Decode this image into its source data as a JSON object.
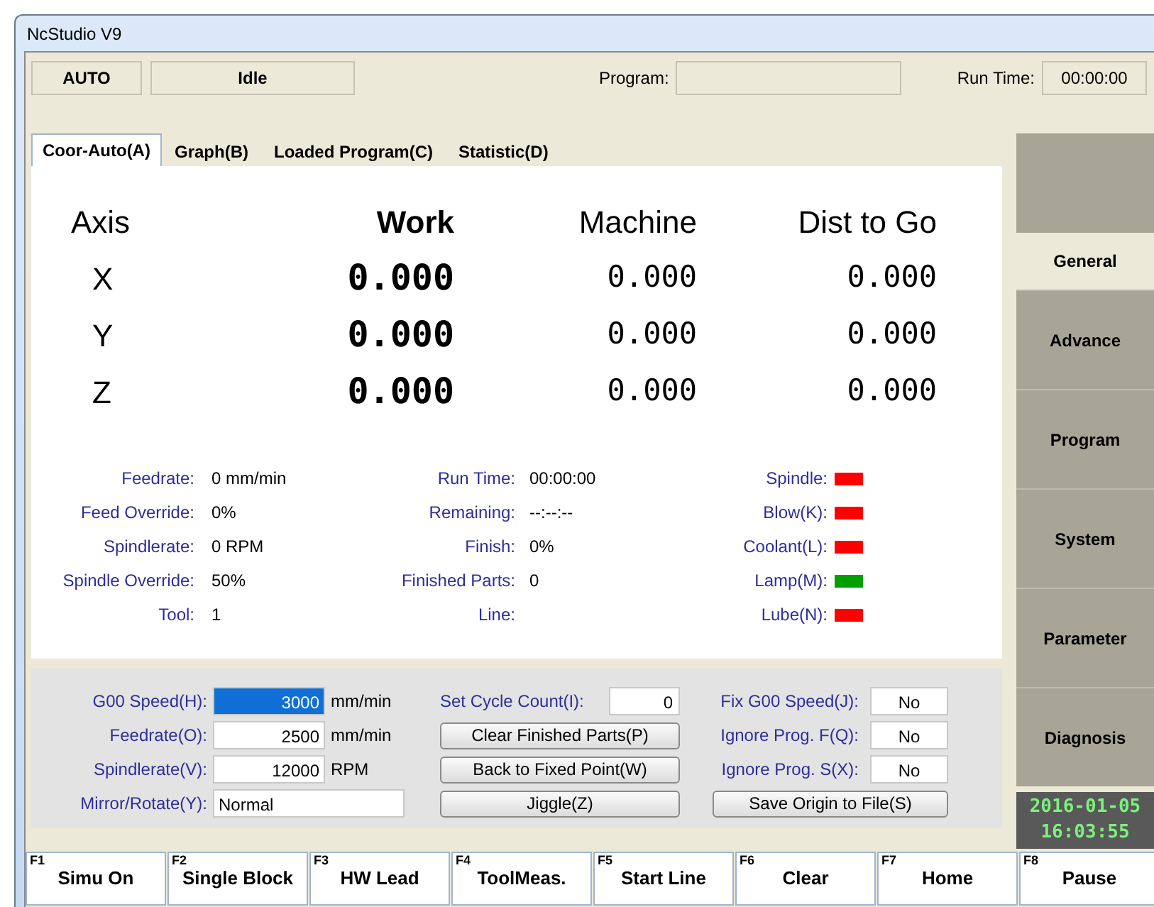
{
  "window": {
    "title": "NcStudio V9"
  },
  "status": {
    "mode": "AUTO",
    "state": "Idle",
    "program_label": "Program:",
    "run_time_label": "Run Time:",
    "run_time": "00:00:00"
  },
  "tabs": [
    {
      "label": "Coor-Auto(A)",
      "selected": true
    },
    {
      "label": "Graph(B)",
      "selected": false
    },
    {
      "label": "Loaded Program(C)",
      "selected": false
    },
    {
      "label": "Statistic(D)",
      "selected": false
    }
  ],
  "coordinates": {
    "headers": [
      "Axis",
      "Work",
      "Machine",
      "Dist to Go"
    ],
    "rows": [
      {
        "axis": "X",
        "work": "0.000",
        "machine": "0.000",
        "dist": "0.000"
      },
      {
        "axis": "Y",
        "work": "0.000",
        "machine": "0.000",
        "dist": "0.000"
      },
      {
        "axis": "Z",
        "work": "0.000",
        "machine": "0.000",
        "dist": "0.000"
      }
    ]
  },
  "info_left": [
    {
      "label": "Feedrate:",
      "value": "0 mm/min"
    },
    {
      "label": "Feed Override:",
      "value": "0%"
    },
    {
      "label": "Spindlerate:",
      "value": "0 RPM"
    },
    {
      "label": "Spindle Override:",
      "value": "50%"
    },
    {
      "label": "Tool:",
      "value": "1"
    }
  ],
  "info_middle": [
    {
      "label": "Run Time:",
      "value": "00:00:00"
    },
    {
      "label": "Remaining:",
      "value": "--:--:--"
    },
    {
      "label": "Finish:",
      "value": "0%"
    },
    {
      "label": "Finished Parts:",
      "value": "0"
    },
    {
      "label": "Line:"
    }
  ],
  "indicators": [
    {
      "label": "Spindle:",
      "color": "#ff0000"
    },
    {
      "label": "Blow(K):",
      "color": "#ff0000"
    },
    {
      "label": "Coolant(L):",
      "color": "#ff0000"
    },
    {
      "label": "Lamp(M):",
      "color": "#00a000"
    },
    {
      "label": "Lube(N):",
      "color": "#ff0000"
    }
  ],
  "settings_left": [
    {
      "label": "G00 Speed(H):",
      "value": "3000",
      "unit": "mm/min",
      "kind": "number",
      "selected": true
    },
    {
      "label": "Feedrate(O):",
      "value": "2500",
      "unit": "mm/min",
      "kind": "number",
      "selected": false
    },
    {
      "label": "Spindlerate(V):",
      "value": "12000",
      "unit": "RPM",
      "kind": "number",
      "selected": false
    },
    {
      "label": "Mirror/Rotate(Y):",
      "value": "Normal",
      "kind": "text",
      "selected": false
    }
  ],
  "settings_middle": [
    {
      "kind": "field",
      "label": "Set Cycle Count(I):",
      "value": "0"
    },
    {
      "kind": "button",
      "label": "Clear Finished Parts(P)"
    },
    {
      "kind": "button",
      "label": "Back to Fixed Point(W)"
    },
    {
      "kind": "button",
      "label": "Jiggle(Z)"
    }
  ],
  "settings_right": [
    {
      "kind": "field",
      "label": "Fix G00 Speed(J):",
      "value": "No"
    },
    {
      "kind": "field",
      "label": "Ignore Prog. F(Q):",
      "value": "No"
    },
    {
      "kind": "field",
      "label": "Ignore Prog. S(X):",
      "value": "No"
    },
    {
      "kind": "button",
      "label": "Save Origin to File(S)"
    }
  ],
  "sidebar": {
    "items": [
      {
        "label": "General",
        "selected": true
      },
      {
        "label": "Advance",
        "selected": false
      },
      {
        "label": "Program",
        "selected": false
      },
      {
        "label": "System",
        "selected": false
      },
      {
        "label": "Parameter",
        "selected": false
      },
      {
        "label": "Diagnosis",
        "selected": false
      }
    ],
    "date": "2016-01-05",
    "time": "16:03:55"
  },
  "function_keys": [
    {
      "key": "F1",
      "label": "Simu On"
    },
    {
      "key": "F2",
      "label": "Single Block"
    },
    {
      "key": "F3",
      "label": "HW Lead"
    },
    {
      "key": "F4",
      "label": "ToolMeas."
    },
    {
      "key": "F5",
      "label": "Start Line"
    },
    {
      "key": "F6",
      "label": "Clear"
    },
    {
      "key": "F7",
      "label": "Home"
    },
    {
      "key": "F8",
      "label": "Pause"
    }
  ]
}
